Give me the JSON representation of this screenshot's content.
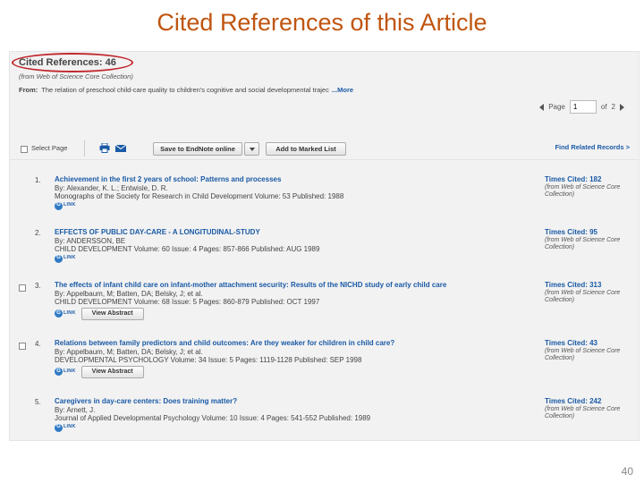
{
  "slide": {
    "title": "Cited References of this Article",
    "page_number": "40"
  },
  "header": {
    "cited_label": "Cited References: 46",
    "from_collection": "(from Web of Science Core Collection)",
    "from_label": "From:",
    "from_text": "The relation of preschool child-care quality to children's cognitive and social developmental trajec",
    "more_label": "...More"
  },
  "pager": {
    "page_label": "Page",
    "current_page": "1",
    "of_label": "of",
    "total_pages": "2"
  },
  "toolbar": {
    "select_page": "Select Page",
    "endnote_button": "Save to EndNote online",
    "marked_list_button": "Add to Marked List",
    "find_related": "Find Related Records >"
  },
  "link_logo": {
    "glyph": "G",
    "text": "LINK"
  },
  "icons": {
    "print": "printer-icon",
    "email": "envelope-icon",
    "dropdown": "chevron-down-icon",
    "prev": "triangle-left-icon",
    "next": "triangle-right-icon"
  },
  "records": [
    {
      "num": "1.",
      "title": "Achievement in the first 2 years of school: Patterns and processes",
      "authors": "By: Alexander, K. L.; Entwisle, D. R.",
      "source": "Monographs of the Society for Research in Child Development   Volume: 53    Published: 1988",
      "times_cited": "Times Cited: 182",
      "wos1": "(from Web of Science Core",
      "wos2": "Collection)",
      "has_checkbox": false,
      "abstract_label": ""
    },
    {
      "num": "2.",
      "title": "EFFECTS OF PUBLIC DAY-CARE - A LONGITUDINAL-STUDY",
      "authors": "By: ANDERSSON, BE",
      "source": "CHILD DEVELOPMENT   Volume: 60   Issue: 4   Pages: 857-866   Published: AUG 1989",
      "times_cited": "Times Cited: 95",
      "wos1": "(from Web of Science Core",
      "wos2": "Collection)",
      "has_checkbox": false,
      "abstract_label": ""
    },
    {
      "num": "3.",
      "title": "The effects of infant child care on infant-mother attachment security: Results of the NICHD study of early child care",
      "authors": "By: Appelbaum, M; Batten, DA; Belsky, J; et al.",
      "source": "CHILD DEVELOPMENT   Volume: 68   Issue: 5   Pages: 860-879   Published: OCT 1997",
      "times_cited": "Times Cited: 313",
      "wos1": "(from Web of Science Core",
      "wos2": "Collection)",
      "has_checkbox": true,
      "abstract_label": "View Abstract"
    },
    {
      "num": "4.",
      "title": "Relations between family predictors and child outcomes: Are they weaker for children in child care?",
      "authors": "By: Appelbaum, M; Batten, DA; Belsky, J; et al.",
      "source": "DEVELOPMENTAL PSYCHOLOGY   Volume: 34   Issue: 5   Pages: 1119-1128   Published: SEP 1998",
      "times_cited": "Times Cited: 43",
      "wos1": "(from Web of Science Core",
      "wos2": "Collection)",
      "has_checkbox": true,
      "abstract_label": "View Abstract"
    },
    {
      "num": "5.",
      "title": "Caregivers in day-care centers: Does training matter?",
      "authors": "By: Arnett, J.",
      "source": "Journal of Applied Developmental Psychology   Volume: 10   Issue: 4   Pages: 541-552   Published: 1989",
      "times_cited": "Times Cited: 242",
      "wos1": "(from Web of Science Core",
      "wos2": "Collection)",
      "has_checkbox": false,
      "abstract_label": ""
    }
  ]
}
